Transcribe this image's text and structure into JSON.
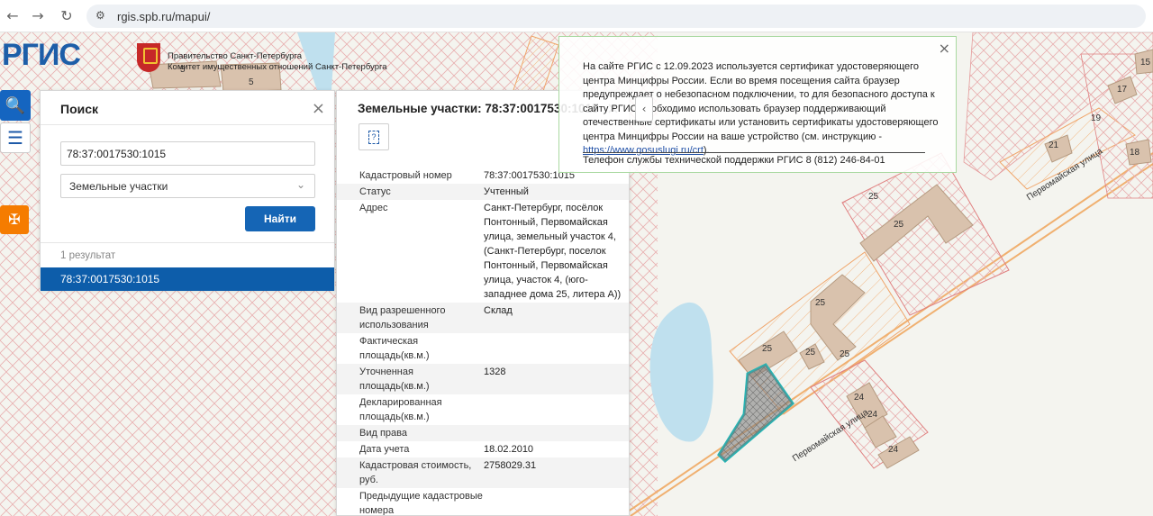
{
  "browser": {
    "back_icon": "arrow-left-icon",
    "forward_icon": "arrow-right-icon",
    "reload_icon": "reload-icon",
    "url": "rgis.spb.ru/mapui/",
    "back_glyph": "←",
    "forward_glyph": "→",
    "reload_glyph": "↻",
    "site_glyph": "⚙"
  },
  "header": {
    "logo_text": "РГИС",
    "gov_line1": "Правительство Санкт-Петербурга",
    "gov_line2": "Комитет имущественных отношений Санкт-Петербурга"
  },
  "tools": {
    "search_glyph": "🔍",
    "menu_glyph": "☰",
    "spb_glyph": "✠"
  },
  "search_panel": {
    "title": "Поиск",
    "close_glyph": "×",
    "query": "78:37:0017530:1015",
    "type_value": "Земельные участки",
    "chevron_glyph": "⌄",
    "find_label": "Найти",
    "results_count": "1 результат",
    "result_item": "78:37:0017530:1015"
  },
  "details": {
    "title": "Земельные участки: 78:37:0017530:1015",
    "close_glyph": "×",
    "doc_glyph": "?",
    "rows": [
      {
        "key": "Кадастровый номер",
        "value": "78:37:0017530:1015"
      },
      {
        "key": "Статус",
        "value": "Учтенный"
      },
      {
        "key": "Адрес",
        "value": "Санкт-Петербург, посёлок Понтонный, Первомайская улица, земельный участок 4, (Санкт-Петербург, поселок Понтонный, Первомайская улица, участок 4, (юго-западнее дома 25, литера А))"
      },
      {
        "key": "Вид разрешенного использования",
        "value": "Склад"
      },
      {
        "key": "Фактическая площадь(кв.м.)",
        "value": ""
      },
      {
        "key": "Уточненная площадь(кв.м.)",
        "value": "1328"
      },
      {
        "key": "Декларированная площадь(кв.м.)",
        "value": ""
      },
      {
        "key": "Вид права",
        "value": ""
      },
      {
        "key": "Дата учета",
        "value": "18.02.2010"
      },
      {
        "key": "Кадастровая стоимость, руб.",
        "value": "2758029.31"
      },
      {
        "key": "Предыдущие кадастровые номера",
        "value": ""
      }
    ]
  },
  "notice": {
    "text_main": "На сайте РГИС с 12.09.2023 используется сертификат удостоверяющего центра Минцифры России. Если во время посещения сайта браузер предупреждает о небезопасном подключении, то для безопасного доступа к сайту РГИС необходимо использовать браузер поддерживающий отечественные сертификаты или установить сертификаты удостоверяющего центра Минцифры России на ваше устройство (см. инструкцию - ",
    "link": "https://www.gosuslugi.ru/crt",
    "text_after_link": ").",
    "phone": "Телефон службы технической поддержки РГИС 8 (812) 246-84-01",
    "close_glyph": "×",
    "prev_glyph": "‹"
  },
  "map": {
    "street_labels": [
      "Первомайская улица",
      "Первомайская улица"
    ],
    "house_numbers": [
      "5",
      "5",
      "15",
      "17",
      "19",
      "18",
      "21",
      "25",
      "25",
      "25",
      "25",
      "25",
      "25",
      "24",
      "24",
      "24"
    ]
  }
}
